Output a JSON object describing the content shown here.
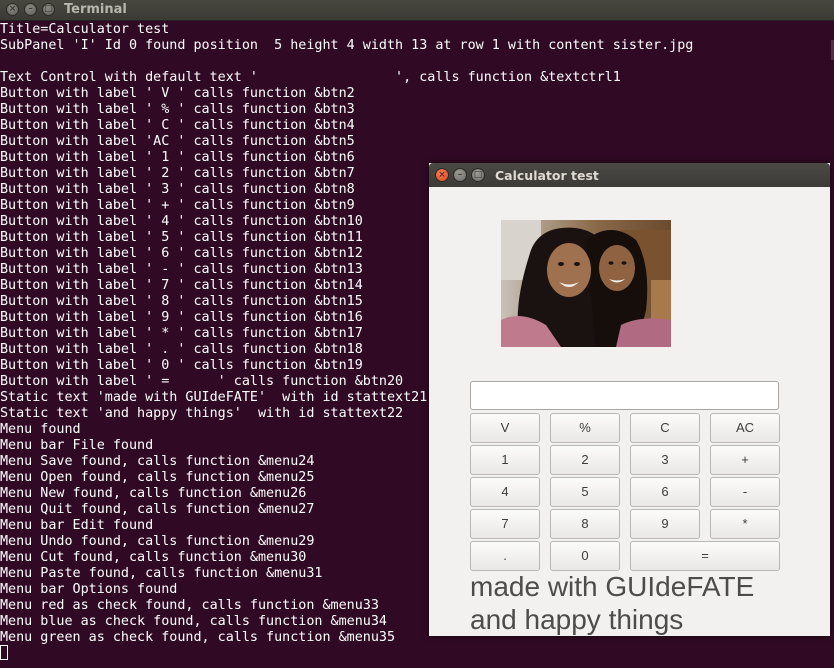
{
  "terminal": {
    "title": "Terminal",
    "lines": [
      "Title=Calculator test",
      "SubPanel 'I' Id 0 found position  5 height 4 width 13 at row 1 with content sister.jpg",
      "",
      "Text Control with default text '                 ', calls function &textctrl1",
      "Button with label ' V ' calls function &btn2",
      "Button with label ' % ' calls function &btn3",
      "Button with label ' C ' calls function &btn4",
      "Button with label 'AC ' calls function &btn5",
      "Button with label ' 1 ' calls function &btn6",
      "Button with label ' 2 ' calls function &btn7",
      "Button with label ' 3 ' calls function &btn8",
      "Button with label ' + ' calls function &btn9",
      "Button with label ' 4 ' calls function &btn10",
      "Button with label ' 5 ' calls function &btn11",
      "Button with label ' 6 ' calls function &btn12",
      "Button with label ' - ' calls function &btn13",
      "Button with label ' 7 ' calls function &btn14",
      "Button with label ' 8 ' calls function &btn15",
      "Button with label ' 9 ' calls function &btn16",
      "Button with label ' * ' calls function &btn17",
      "Button with label ' . ' calls function &btn18",
      "Button with label ' 0 ' calls function &btn19",
      "Button with label ' =      ' calls function &btn20",
      "Static text 'made with GUIdeFATE'  with id stattext21",
      "Static text 'and happy things'  with id stattext22",
      "Menu found",
      "Menu bar File found",
      "Menu Save found, calls function &menu24",
      "Menu Open found, calls function &menu25",
      "Menu New found, calls function &menu26",
      "Menu Quit found, calls function &menu27",
      "Menu bar Edit found",
      "Menu Undo found, calls function &menu29",
      "Menu Cut found, calls function &menu30",
      "Menu Paste found, calls function &menu31",
      "Menu bar Options found",
      "Menu red as check found, calls function &menu33",
      "Menu blue as check found, calls function &menu34",
      "Menu green as check found, calls function &menu35"
    ]
  },
  "calculator": {
    "title": "Calculator test",
    "input_value": "",
    "buttons": [
      "V",
      "%",
      "C",
      "AC",
      "1",
      "2",
      "3",
      "+",
      "4",
      "5",
      "6",
      "-",
      "7",
      "8",
      "9",
      "*",
      ".",
      "0",
      "="
    ],
    "static_text_1": "made with GUIdeFATE",
    "static_text_2": "and happy things"
  },
  "colors": {
    "terminal_bg": "#300a24",
    "close_button": "#e95420"
  }
}
